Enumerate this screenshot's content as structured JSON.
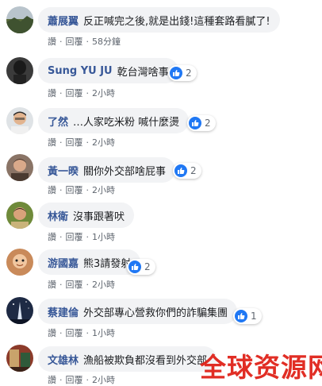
{
  "comments": [
    {
      "author": "蕭展翼",
      "text": "反正喊完之後,就是出錢!這種套路看膩了!",
      "like_label": "讚",
      "reply_label": "回覆",
      "time": "58分鐘",
      "reactions": ""
    },
    {
      "author": "Sung YU JU",
      "text": "乾台灣啥事",
      "like_label": "讚",
      "reply_label": "回覆",
      "time": "2小時",
      "reactions": "2"
    },
    {
      "author": "了然",
      "text": "…人家吃米粉 喊什麼燙",
      "like_label": "讚",
      "reply_label": "回覆",
      "time": "2小時",
      "reactions": "2"
    },
    {
      "author": "黃一暌",
      "text": "關你外交部啥屁事",
      "like_label": "讚",
      "reply_label": "回覆",
      "time": "2小時",
      "reactions": "2"
    },
    {
      "author": "林衛",
      "text": "沒事跟著吠",
      "like_label": "讚",
      "reply_label": "回覆",
      "time": "1小時",
      "reactions": ""
    },
    {
      "author": "游國嘉",
      "text": "熊3請發射",
      "like_label": "讚",
      "reply_label": "回覆",
      "time": "2小時",
      "reactions": "2"
    },
    {
      "author": "蔡建倫",
      "text": "外交部專心營救你們的詐騙集團",
      "like_label": "讚",
      "reply_label": "回覆",
      "time": "1小時",
      "reactions": "1"
    },
    {
      "author": "文雄林",
      "text": "漁船被欺負都沒看到外交部",
      "like_label": "讚",
      "reply_label": "回覆",
      "time": "2小時",
      "reactions": ""
    }
  ],
  "watermark": "全球资源网",
  "colors": {
    "author": "#385898",
    "bubble": "#f2f3f5",
    "meta": "#606770",
    "like": "#2078f4",
    "watermark": "#e0231a"
  }
}
